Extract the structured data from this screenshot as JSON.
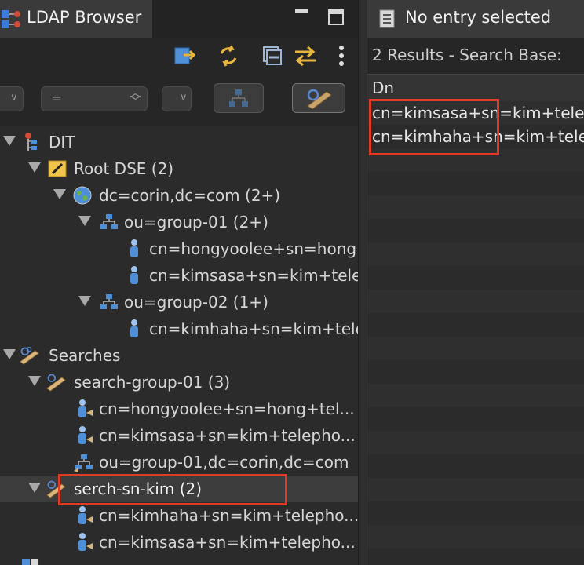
{
  "left_panel": {
    "title": "LDAP Browser",
    "filter": {
      "operator_value": "="
    },
    "tree": [
      {
        "label": "DIT",
        "icon": "dit-icon"
      },
      {
        "label": "Root DSE (2)",
        "icon": "root-dse-icon"
      },
      {
        "label": "dc=corin,dc=com (2+)",
        "icon": "globe-icon"
      },
      {
        "label": "ou=group-01 (2+)",
        "icon": "org-unit-icon"
      },
      {
        "label": "cn=hongyoolee+sn=hong",
        "icon": "person-icon"
      },
      {
        "label": "cn=kimsasa+sn=kim+tele",
        "icon": "person-icon"
      },
      {
        "label": "ou=group-02 (1+)",
        "icon": "org-unit-icon"
      },
      {
        "label": "cn=kimhaha+sn=kim+tele",
        "icon": "person-icon"
      },
      {
        "label": "Searches",
        "icon": "searches-icon"
      },
      {
        "label": "search-group-01 (3)",
        "icon": "search-icon"
      },
      {
        "label": "cn=hongyoolee+sn=hong+tel...",
        "icon": "person-result-icon"
      },
      {
        "label": "cn=kimsasa+sn=kim+telepho...",
        "icon": "person-result-icon"
      },
      {
        "label": "ou=group-01,dc=corin,dc=com",
        "icon": "org-unit-result-icon"
      },
      {
        "label": "serch-sn-kim (2)",
        "icon": "search-icon"
      },
      {
        "label": "cn=kimhaha+sn=kim+telepho...",
        "icon": "person-result-icon"
      },
      {
        "label": "cn=kimsasa+sn=kim+telepho...",
        "icon": "person-result-icon"
      }
    ]
  },
  "right_panel": {
    "title": "No entry selected",
    "results_summary": "2 Results  -  Search Base:",
    "table": {
      "column_header": "Dn",
      "rows": [
        "cn=kimsasa+sn=kim+telep",
        "cn=kimhaha+sn=kim+tele"
      ]
    }
  },
  "colors": {
    "highlight": "#e03b24",
    "background": "#2b2b2b",
    "selection": "#3c3c3c"
  }
}
